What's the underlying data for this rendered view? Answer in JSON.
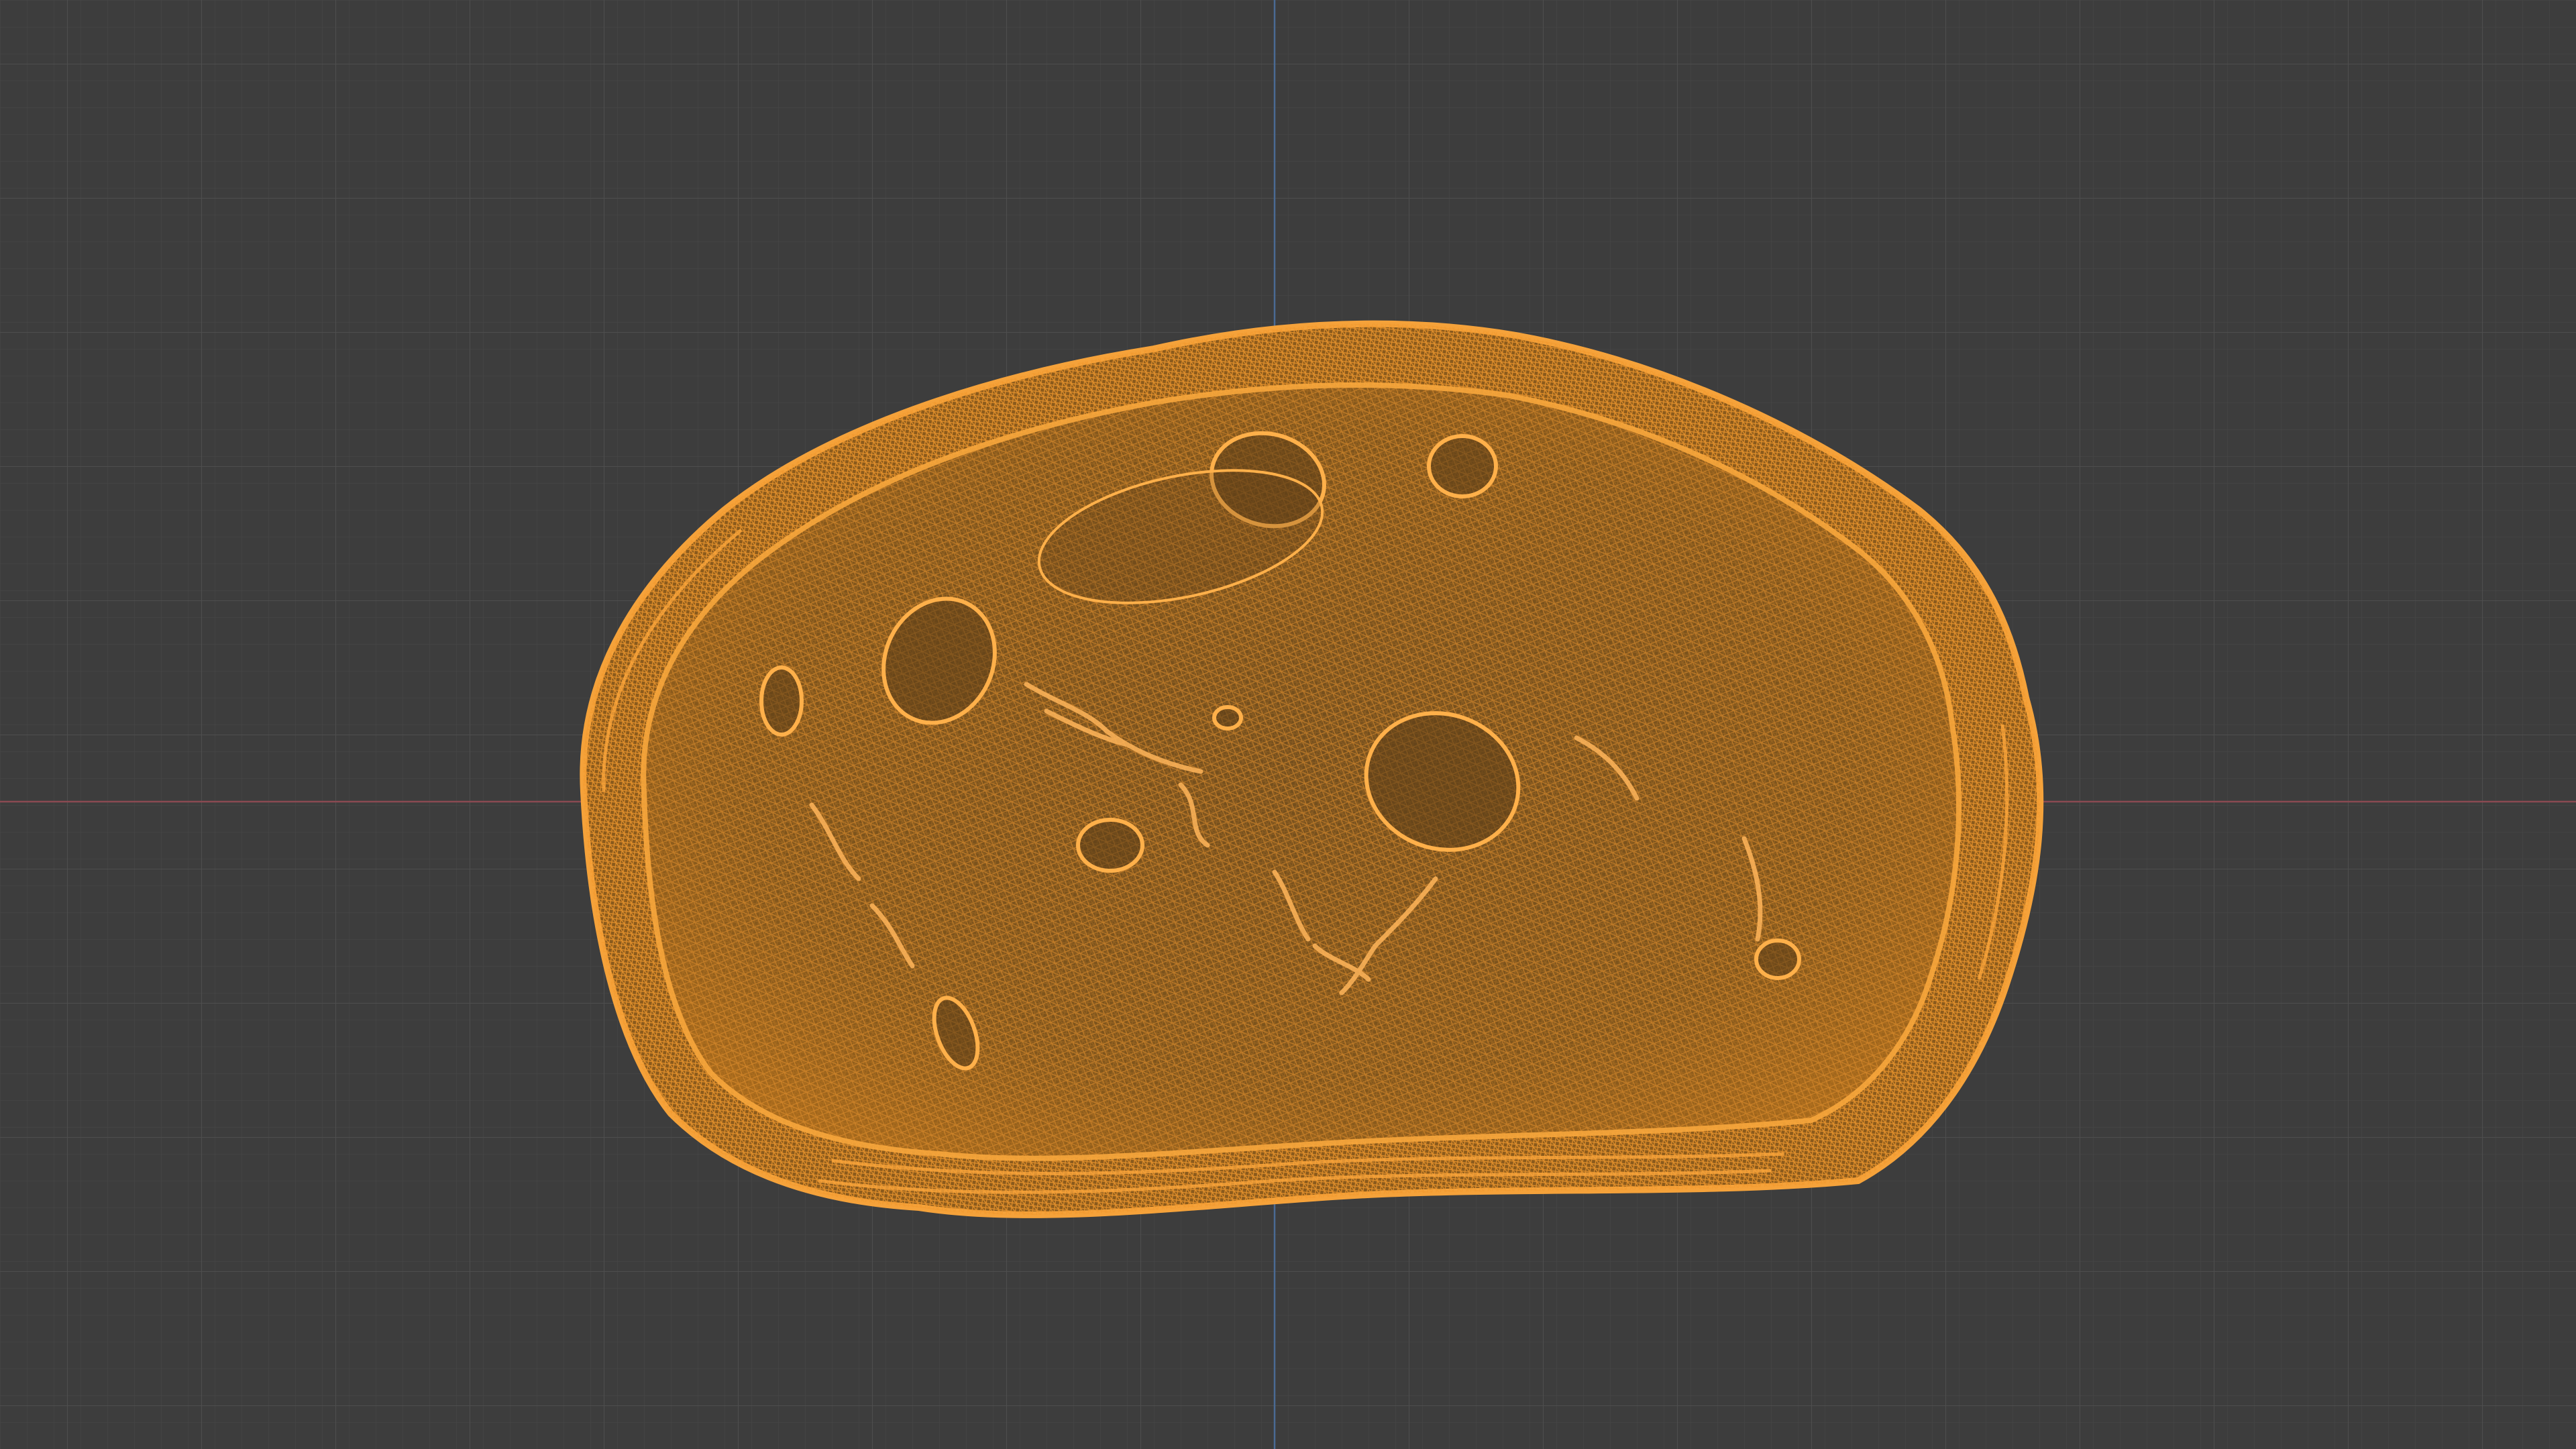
{
  "viewport": {
    "view": "orthographic-front",
    "shading": "wireframe",
    "background_color": "#3d3d3d",
    "grid_minor_color": "#454545",
    "grid_major_color": "#505050",
    "x_axis_color": "#8a4a52",
    "z_axis_color": "#4a6a94",
    "selection_color": "#f0962a"
  },
  "object": {
    "semantic": "bread-slice-mesh",
    "selected": true,
    "mode": "object"
  }
}
